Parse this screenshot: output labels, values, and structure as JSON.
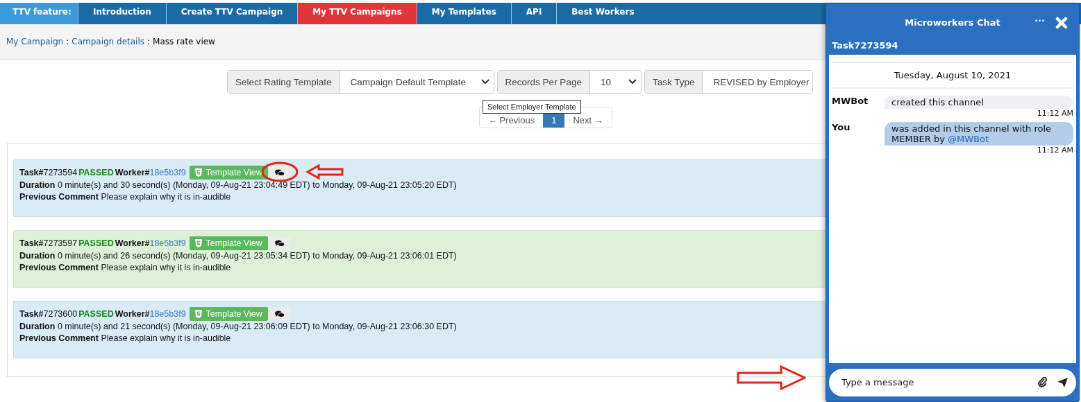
{
  "nav": {
    "label": "TTV feature:",
    "tabs": [
      {
        "label": "Introduction",
        "selected": false
      },
      {
        "label": "Create TTV Campaign",
        "selected": false
      },
      {
        "label": "My TTV Campaigns",
        "selected": true
      },
      {
        "label": "My Templates",
        "selected": false
      },
      {
        "label": "API",
        "selected": false
      },
      {
        "label": "Best Workers",
        "selected": false
      }
    ]
  },
  "breadcrumb": {
    "links": [
      "My Campaign",
      "Campaign details"
    ],
    "separator": ":",
    "current": "Mass rate view"
  },
  "filters": [
    {
      "label": "Select Rating Template",
      "value": "Campaign Default Template"
    },
    {
      "label": "Records Per Page",
      "value": "10"
    },
    {
      "label": "Task Type",
      "value": "REVISED by Employer"
    }
  ],
  "tooltip": "Select Employer Template",
  "pagination": {
    "previous": "← Previous",
    "page": "1",
    "next": "Next →"
  },
  "tasks": [
    {
      "kind": "info",
      "task_label": "Task#",
      "task": "7273594",
      "status": "PASSED",
      "worker_label": "Worker#",
      "worker": "18e5b3f9",
      "button": "Template View",
      "duration_label": "Duration",
      "duration": "0 minute(s) and 30 second(s) (Monday, 09-Aug-21 23:04:49 EDT) to Monday, 09-Aug-21 23:05:20 EDT)",
      "comment_label": "Previous Comment",
      "comment": "Please explain why it is in-audible",
      "highlighted": true
    },
    {
      "kind": "success",
      "task_label": "Task#",
      "task": "7273597",
      "status": "PASSED",
      "worker_label": "Worker#",
      "worker": "18e5b3f9",
      "button": "Template View",
      "duration_label": "Duration",
      "duration": "0 minute(s) and 26 second(s) (Monday, 09-Aug-21 23:05:34 EDT) to Monday, 09-Aug-21 23:06:01 EDT)",
      "comment_label": "Previous Comment",
      "comment": "Please explain why it is in-audible",
      "highlighted": false
    },
    {
      "kind": "info",
      "task_label": "Task#",
      "task": "7273600",
      "status": "PASSED",
      "worker_label": "Worker#",
      "worker": "18e5b3f9",
      "button": "Template View",
      "duration_label": "Duration",
      "duration": "0 minute(s) and 21 second(s) (Monday, 09-Aug-21 23:06:09 EDT) to Monday, 09-Aug-21 23:06:30 EDT)",
      "comment_label": "Previous Comment",
      "comment": "Please explain why it is in-audible",
      "highlighted": false
    }
  ],
  "chat": {
    "title": "Microworkers Chat",
    "menu": "...",
    "channel": "Task7273594",
    "date": "Tuesday, August 10, 2021",
    "messages": [
      {
        "kind": "system",
        "sender": "MWBot",
        "text": "created this channel",
        "time": "11:12 AM"
      },
      {
        "kind": "own",
        "sender": "You",
        "text": "was added in this channel with role MEMBER by",
        "mention": "@MWBot",
        "time": "11:12 AM"
      }
    ],
    "input": {
      "placeholder": "Type a message"
    }
  }
}
